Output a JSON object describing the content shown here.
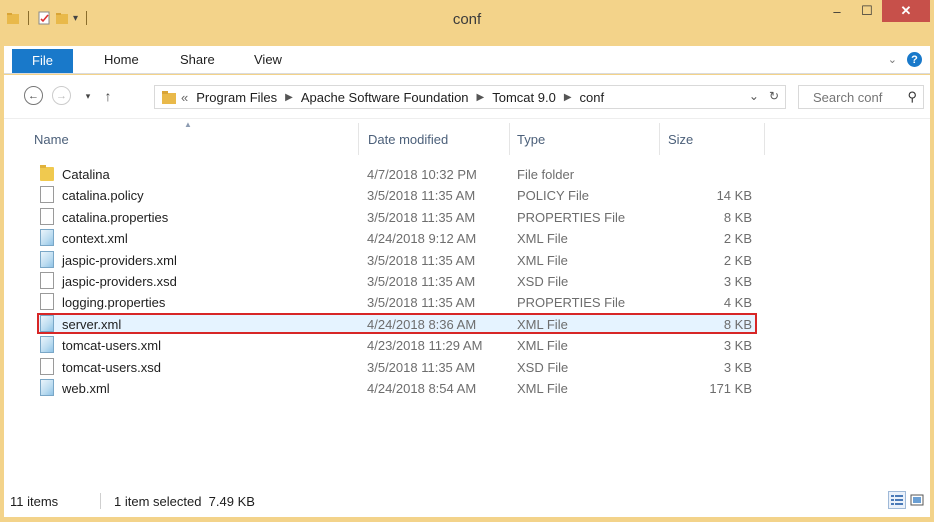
{
  "window": {
    "title": "conf",
    "minimize_glyph": "–",
    "maximize_glyph": "☐",
    "close_glyph": "✕"
  },
  "ribbon": {
    "tabs": [
      "File",
      "Home",
      "Share",
      "View"
    ]
  },
  "address": {
    "overflow": "«",
    "crumbs": [
      "Program Files",
      "Apache Software Foundation",
      "Tomcat 9.0",
      "conf"
    ],
    "search_placeholder": "Search conf"
  },
  "columns": {
    "name": "Name",
    "date": "Date modified",
    "type": "Type",
    "size": "Size"
  },
  "files": [
    {
      "name": "Catalina",
      "date": "4/7/2018 10:32 PM",
      "type": "File folder",
      "size": "",
      "icon": "folder-icon"
    },
    {
      "name": "catalina.policy",
      "date": "3/5/2018 11:35 AM",
      "type": "POLICY File",
      "size": "14 KB",
      "icon": "file-icon"
    },
    {
      "name": "catalina.properties",
      "date": "3/5/2018 11:35 AM",
      "type": "PROPERTIES File",
      "size": "8 KB",
      "icon": "file-icon"
    },
    {
      "name": "context.xml",
      "date": "4/24/2018 9:12 AM",
      "type": "XML File",
      "size": "2 KB",
      "icon": "xml-file-icon"
    },
    {
      "name": "jaspic-providers.xml",
      "date": "3/5/2018 11:35 AM",
      "type": "XML File",
      "size": "2 KB",
      "icon": "xml-file-icon"
    },
    {
      "name": "jaspic-providers.xsd",
      "date": "3/5/2018 11:35 AM",
      "type": "XSD File",
      "size": "3 KB",
      "icon": "file-icon"
    },
    {
      "name": "logging.properties",
      "date": "3/5/2018 11:35 AM",
      "type": "PROPERTIES File",
      "size": "4 KB",
      "icon": "file-icon"
    },
    {
      "name": "server.xml",
      "date": "4/24/2018 8:36 AM",
      "type": "XML File",
      "size": "8 KB",
      "icon": "xml-file-icon",
      "selected": true
    },
    {
      "name": "tomcat-users.xml",
      "date": "4/23/2018 11:29 AM",
      "type": "XML File",
      "size": "3 KB",
      "icon": "xml-file-icon"
    },
    {
      "name": "tomcat-users.xsd",
      "date": "3/5/2018 11:35 AM",
      "type": "XSD File",
      "size": "3 KB",
      "icon": "file-icon"
    },
    {
      "name": "web.xml",
      "date": "4/24/2018 8:54 AM",
      "type": "XML File",
      "size": "171 KB",
      "icon": "xml-file-icon"
    }
  ],
  "status": {
    "items": "11 items",
    "selection": "1 item selected  7.49 KB"
  },
  "colors": {
    "title_bar": "#f3d38a",
    "file_tab": "#1979ca",
    "close_button": "#c7504a",
    "selection_outline": "#d72626"
  }
}
